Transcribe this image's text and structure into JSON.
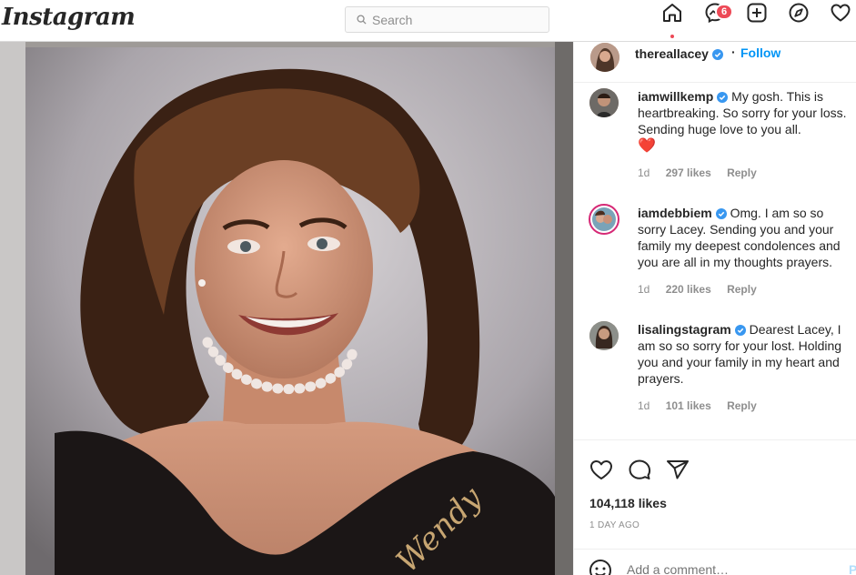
{
  "nav": {
    "logo": "Instagram",
    "search_placeholder": "Search",
    "messenger_badge": "6"
  },
  "post": {
    "owner": "thereallacey",
    "follow_label": "Follow",
    "separator": "·",
    "photo_caption_text": "Wendy",
    "likes": "104,118 likes",
    "date": "1 DAY AGO",
    "add_comment_placeholder": "Add a comment…",
    "post_label": "P"
  },
  "comments": [
    {
      "user": "iamwillkemp",
      "text": "My gosh. This is heartbreaking. So sorry for your loss. Sending huge love to you all.",
      "emoji": "❤️",
      "age": "1d",
      "likes": "297 likes",
      "reply": "Reply"
    },
    {
      "user": "iamdebbiem",
      "text": "Omg. I am so so sorry Lacey. Sending you and your family my deepest condolences and you are all in my thoughts prayers.",
      "age": "1d",
      "likes": "220 likes",
      "reply": "Reply"
    },
    {
      "user": "lisalingstagram",
      "text": "Dearest Lacey, I am so so sorry for your lost. Holding you and your family in my heart and prayers.",
      "age": "1d",
      "likes": "101 likes",
      "reply": "Reply"
    }
  ],
  "colors": {
    "accent": "#0095f6",
    "badge": "#ed4956",
    "verified": "#3897f0"
  }
}
